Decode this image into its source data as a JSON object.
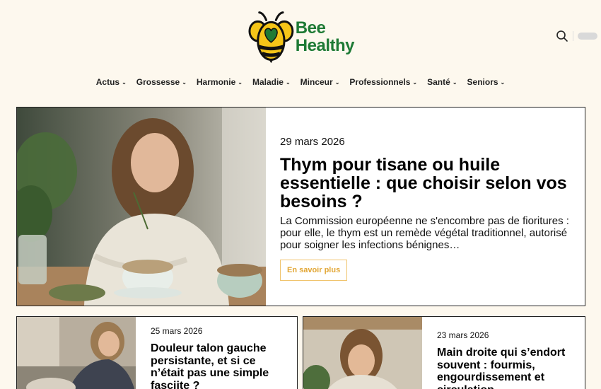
{
  "brand": {
    "line1": "Bee",
    "line2": "Healthy",
    "logo_icon": "bee-heart-logo"
  },
  "header": {
    "search_icon": "search-icon"
  },
  "nav": {
    "items": [
      {
        "label": "Actus"
      },
      {
        "label": "Grossesse"
      },
      {
        "label": "Harmonie"
      },
      {
        "label": "Maladie"
      },
      {
        "label": "Minceur"
      },
      {
        "label": "Professionnels"
      },
      {
        "label": "Santé"
      },
      {
        "label": "Seniors"
      }
    ]
  },
  "featured": {
    "date": "29 mars 2026",
    "title": "Thym pour tisane ou huile essentielle : que choisir selon vos besoins ?",
    "excerpt": "La Commission européenne ne s'encombre pas de fioritures : pour elle, le thym est un remède végétal traditionnel, autorisé pour soigner les infections bénignes…",
    "button": "En savoir plus"
  },
  "cards": [
    {
      "date": "25 mars 2026",
      "title": "Douleur talon gauche persistante, et si ce n’était pas une simple fasciite ?"
    },
    {
      "date": "23 mars 2026",
      "title": "Main droite qui s’endort souvent : fourmis, engourdissement et circulation"
    }
  ],
  "colors": {
    "background": "#fdf8ee",
    "brand_green": "#1e7a35",
    "accent": "#e2a634",
    "bee_yellow": "#f5c518"
  }
}
